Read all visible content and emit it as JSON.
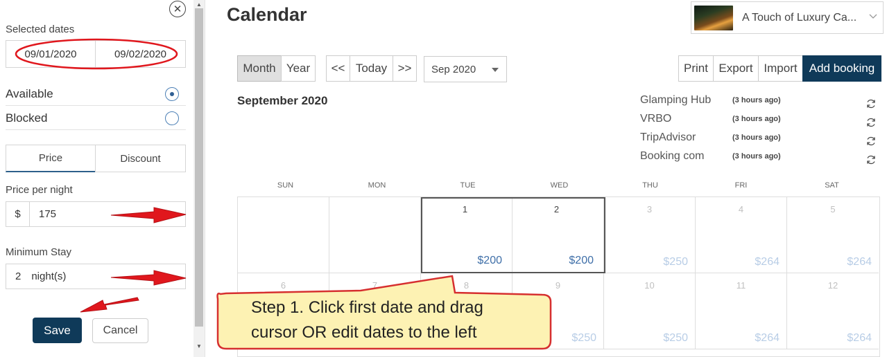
{
  "left_panel": {
    "selected_dates_label": "Selected dates",
    "start_date": "09/01/2020",
    "end_date": "09/02/2020",
    "availability": [
      {
        "label": "Available",
        "selected": true
      },
      {
        "label": "Blocked",
        "selected": false
      }
    ],
    "tabs": [
      {
        "label": "Price",
        "active": true
      },
      {
        "label": "Discount",
        "active": false
      }
    ],
    "price_label": "Price per night",
    "currency_symbol": "$",
    "price_value": "175",
    "min_stay_label": "Minimum Stay",
    "min_stay_value": "2",
    "min_stay_unit": "night(s)",
    "save_label": "Save",
    "cancel_label": "Cancel"
  },
  "header": {
    "title": "Calendar",
    "property_name": "A Touch of Luxury Ca..."
  },
  "toolbar": {
    "month_label": "Month",
    "year_label": "Year",
    "prev_label": "<<",
    "today_label": "Today",
    "next_label": ">>",
    "month_select_value": "Sep 2020",
    "print_label": "Print",
    "export_label": "Export",
    "import_label": "Import",
    "add_booking_label": "Add booking"
  },
  "calendar": {
    "month_heading": "September 2020",
    "sync_sources": [
      {
        "name": "Glamping Hub",
        "time": "(3 hours ago)"
      },
      {
        "name": "VRBO",
        "time": "(3 hours ago)"
      },
      {
        "name": "TripAdvisor",
        "time": "(3 hours ago)"
      },
      {
        "name": "Booking com",
        "time": "(3 hours ago)"
      }
    ],
    "weekdays": [
      "SUN",
      "MON",
      "TUE",
      "WED",
      "THU",
      "FRI",
      "SAT"
    ],
    "week1": [
      {
        "day": "",
        "price": ""
      },
      {
        "day": "",
        "price": ""
      },
      {
        "day": "1",
        "price": "$200"
      },
      {
        "day": "2",
        "price": "$200"
      },
      {
        "day": "3",
        "price": "$250"
      },
      {
        "day": "4",
        "price": "$264"
      },
      {
        "day": "5",
        "price": "$264"
      }
    ],
    "week2": [
      {
        "day": "6",
        "price": ""
      },
      {
        "day": "7",
        "price": ""
      },
      {
        "day": "8",
        "price": ""
      },
      {
        "day": "9",
        "price": "$250"
      },
      {
        "day": "10",
        "price": "$250"
      },
      {
        "day": "11",
        "price": "$264"
      },
      {
        "day": "12",
        "price": "$264"
      }
    ]
  },
  "annotation": {
    "line1": "Step 1. Click first date and drag",
    "line2": "cursor OR edit dates to the left"
  },
  "colors": {
    "primary_dark": "#0f3a59",
    "price_blue": "#3f6fa8",
    "annotation_red": "#e0171d",
    "callout_fill": "#fdf2b3"
  }
}
